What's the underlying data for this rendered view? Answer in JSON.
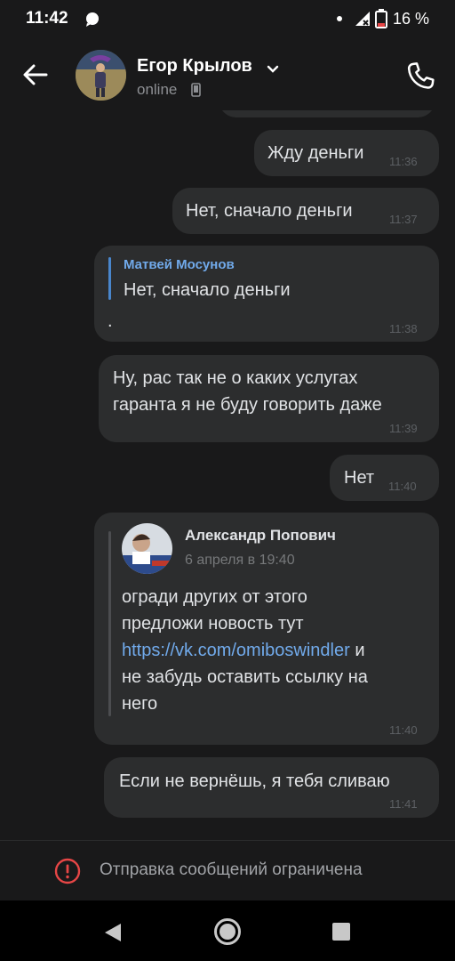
{
  "status_bar": {
    "time": "11:42",
    "battery_text": "16 %",
    "icons": [
      "message-notification-icon",
      "dot-icon",
      "signal-icon",
      "battery-icon"
    ]
  },
  "header": {
    "name": "Егор Крылов",
    "status": "online",
    "icons": [
      "back-arrow-icon",
      "chevron-down-icon",
      "mobile-icon",
      "phone-icon"
    ]
  },
  "messages": [
    {
      "text": "Жду деньги",
      "time": "11:36"
    },
    {
      "text": "Нет, сначало деньги",
      "time": "11:37"
    },
    {
      "reply_author": "Матвей Мосунов",
      "reply_text": "Нет, сначало деньги",
      "text": ".",
      "time": "11:38"
    },
    {
      "lines": [
        "Ну, рас так не о каких услугах",
        "гаранта я не буду говорить даже"
      ],
      "time": "11:39"
    },
    {
      "text": "Нет",
      "time": "11:40"
    },
    {
      "forward_author": "Александр Попович",
      "forward_date": "6 апреля в 19:40",
      "lines": [
        "огради других от этого",
        "предложи новость тут"
      ],
      "link": "https://vk.com/omiboswindler",
      "link_suffix": " и",
      "lines_after": [
        "не забудь оставить ссылку на",
        "него"
      ],
      "time": "11:40"
    },
    {
      "text": "Если не вернёшь, я тебя сливаю",
      "time": "11:41"
    }
  ],
  "restricted": {
    "text": "Отправка сообщений ограничена"
  },
  "colors": {
    "background": "#19191a",
    "bubble": "#2c2d2e",
    "accent": "#71aaeb",
    "warning": "#e64646"
  }
}
